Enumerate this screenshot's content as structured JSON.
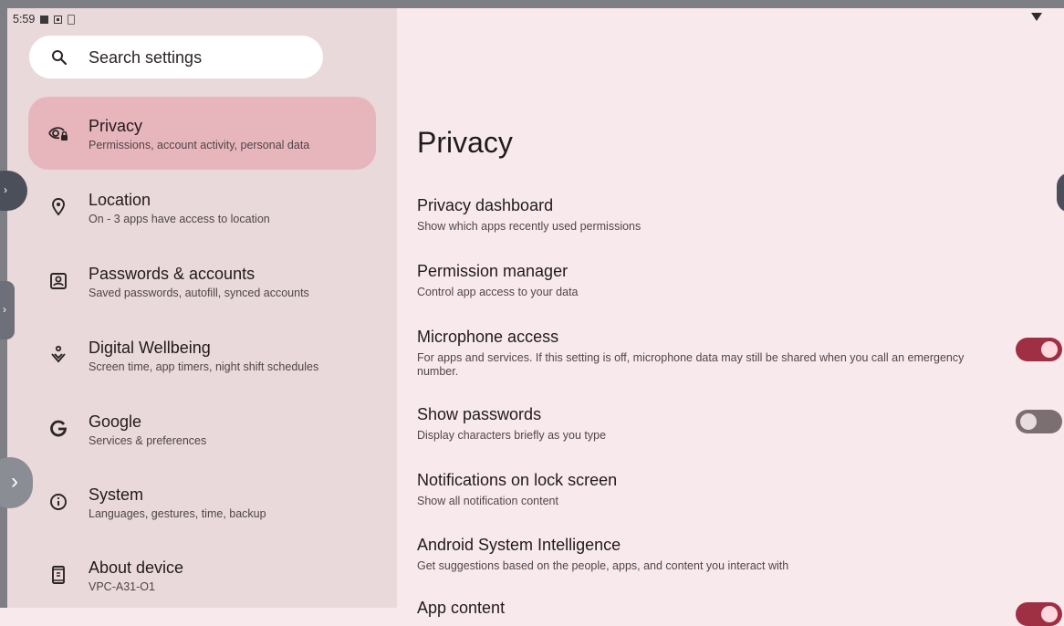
{
  "status_bar": {
    "time": "5:59"
  },
  "search": {
    "placeholder": "Search settings"
  },
  "sidebar": {
    "items": [
      {
        "title": "Privacy",
        "subtitle": "Permissions, account activity, personal data",
        "icon": "privacy-eye-lock-icon",
        "selected": true
      },
      {
        "title": "Location",
        "subtitle": "On - 3 apps have access to location",
        "icon": "location-pin-icon",
        "selected": false
      },
      {
        "title": "Passwords & accounts",
        "subtitle": "Saved passwords, autofill, synced accounts",
        "icon": "account-box-icon",
        "selected": false
      },
      {
        "title": "Digital Wellbeing",
        "subtitle": "Screen time, app timers, night shift schedules",
        "icon": "wellbeing-icon",
        "selected": false
      },
      {
        "title": "Google",
        "subtitle": "Services & preferences",
        "icon": "google-g-icon",
        "selected": false
      },
      {
        "title": "System",
        "subtitle": "Languages, gestures, time, backup",
        "icon": "info-icon",
        "selected": false
      },
      {
        "title": "About device",
        "subtitle": "VPC-A31-O1",
        "icon": "device-icon",
        "selected": false
      }
    ]
  },
  "main": {
    "title": "Privacy",
    "prefs": [
      {
        "title": "Privacy dashboard",
        "subtitle": "Show which apps recently used permissions"
      },
      {
        "title": "Permission manager",
        "subtitle": "Control app access to your data"
      },
      {
        "title": "Microphone access",
        "subtitle": "For apps and services. If this setting is off, microphone data may still be shared when you call an emergency number.",
        "toggle": true
      },
      {
        "title": "Show passwords",
        "subtitle": "Display characters briefly as you type",
        "toggle": false
      },
      {
        "title": "Notifications on lock screen",
        "subtitle": "Show all notification content"
      },
      {
        "title": "Android System Intelligence",
        "subtitle": "Get suggestions based on the people, apps, and content you interact with"
      },
      {
        "title": "App content"
      }
    ]
  },
  "colors": {
    "accent": "#9f3044",
    "selected_bg": "#e7b6bc",
    "sidebar_bg": "#ead9da",
    "content_bg": "#f8eaec"
  }
}
